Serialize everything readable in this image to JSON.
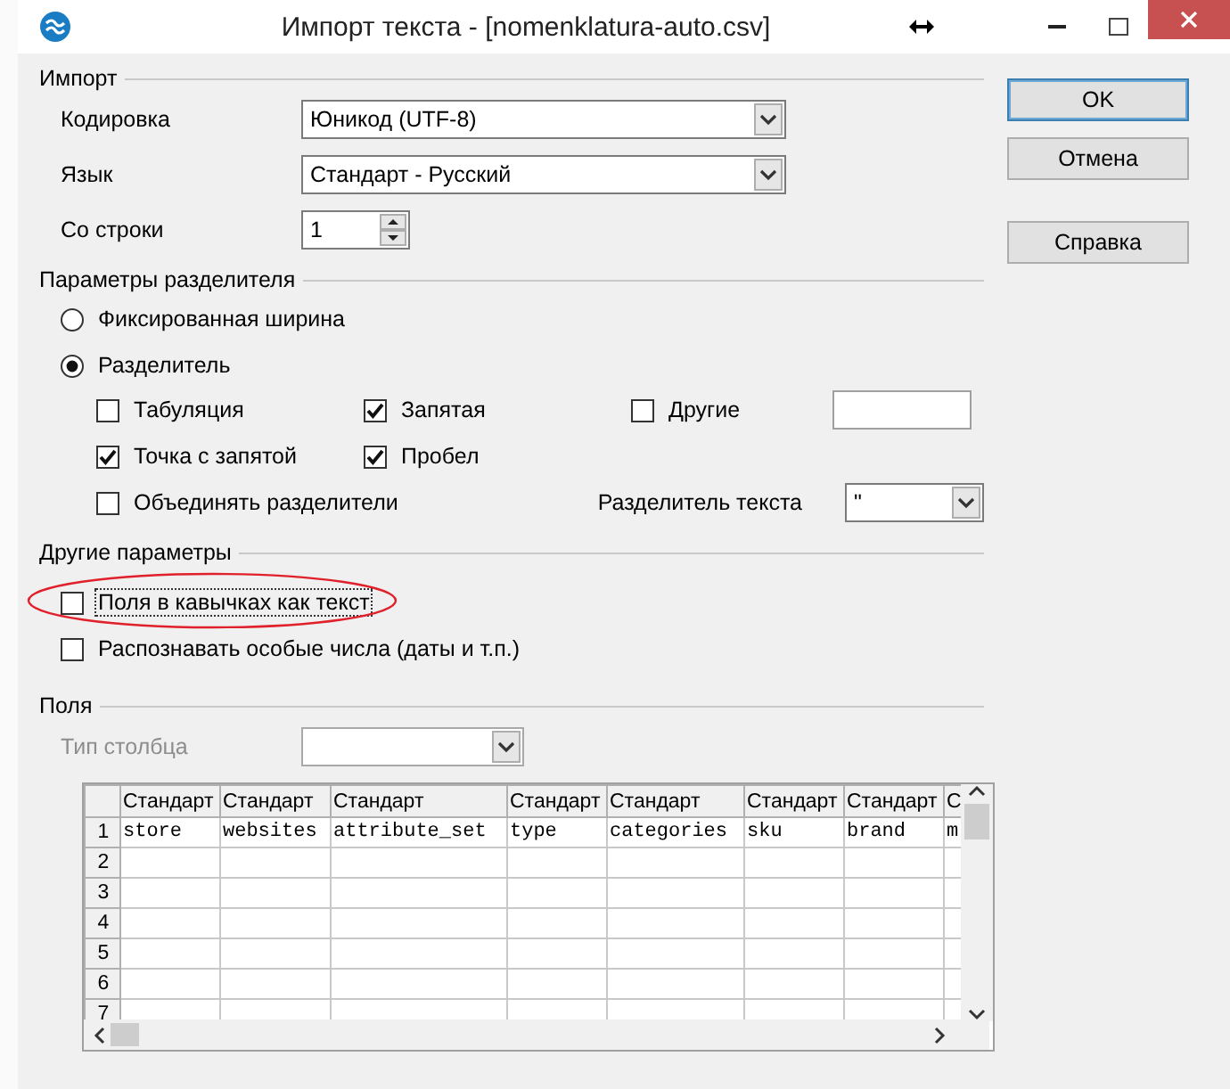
{
  "window": {
    "title": "Импорт текста - [nomenklatura-auto.csv]"
  },
  "import": {
    "heading": "Импорт",
    "fields": [
      {
        "label": "Кодировка",
        "kind": "combo",
        "value": "Юникод (UTF-8)"
      },
      {
        "label": "Язык",
        "kind": "combo",
        "value": "Стандарт - Русский"
      },
      {
        "label": "Со строки",
        "kind": "spin",
        "value": "1"
      }
    ]
  },
  "separator_options": {
    "heading": "Параметры разделителя",
    "modes": [
      {
        "label": "Фиксированная ширина",
        "selected": false
      },
      {
        "label": "Разделитель",
        "selected": true
      }
    ],
    "separators": [
      {
        "label": "Табуляция",
        "checked": false,
        "kind": "check"
      },
      {
        "label": "Запятая",
        "checked": true,
        "kind": "check"
      },
      {
        "label": "Другие",
        "checked": false,
        "kind": "check_with_field"
      },
      {
        "label": "Точка с запятой",
        "checked": true,
        "kind": "check"
      },
      {
        "label": "Пробел",
        "checked": true,
        "kind": "check"
      }
    ],
    "merge": {
      "label": "Объединять разделители",
      "checked": false
    },
    "text_delimiter": {
      "label": "Разделитель текста",
      "value": "\""
    }
  },
  "other_options": {
    "heading": "Другие параметры",
    "options": [
      {
        "label": "Поля в кавычках как текст",
        "checked": false,
        "focused": true,
        "circled": true
      },
      {
        "label": "Распознавать особые числа (даты и т.п.)",
        "checked": false,
        "focused": false,
        "circled": false
      }
    ]
  },
  "fields": {
    "heading": "Поля",
    "column_type": {
      "label": "Тип столбца",
      "disabled": true
    },
    "table": {
      "columns": [
        "Стандарт",
        "Стандарт",
        "Стандарт",
        "Стандарт",
        "Стандарт",
        "Стандарт",
        "Стандарт",
        "С"
      ],
      "rows": [
        {
          "number": "1",
          "cells": [
            "store",
            "websites",
            "attribute_set",
            "type",
            "categories",
            "sku",
            "brand",
            "m"
          ]
        },
        {
          "number": "2"
        },
        {
          "number": "3"
        },
        {
          "number": "4"
        },
        {
          "number": "5"
        },
        {
          "number": "6"
        },
        {
          "number": "7"
        }
      ]
    }
  },
  "buttons": [
    {
      "label": "OK",
      "default": true
    },
    {
      "label": "Отмена",
      "default": false
    },
    {
      "label": "Справка",
      "default": false
    }
  ]
}
